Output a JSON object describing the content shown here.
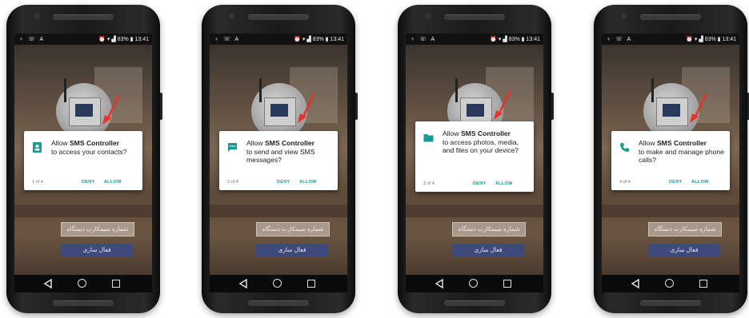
{
  "status_bar": {
    "left_icons": "♀ ☏ A",
    "right_icons": "⏰ ▾ ▟ 83% ▮",
    "time": "13:41"
  },
  "phones": [
    {
      "dialog": {
        "line1_prefix": "Allow",
        "app_name": "SMS Controller",
        "message": "to access your contacts?",
        "counter": "1 of 4",
        "deny": "DENY",
        "allow": "ALLOW",
        "icon": "contacts-icon"
      }
    },
    {
      "dialog": {
        "line1_prefix": "Allow",
        "app_name": "SMS Controller",
        "message": "to send and view SMS messages?",
        "counter": "2 of 4",
        "deny": "DENY",
        "allow": "ALLOW",
        "icon": "sms-icon"
      }
    },
    {
      "dialog": {
        "line1_prefix": "Allow",
        "app_name": "SMS Controller",
        "message": "to access photos, media, and files on your device?",
        "counter": "3 of 4",
        "deny": "DENY",
        "allow": "ALLOW",
        "icon": "folder-icon"
      }
    },
    {
      "dialog": {
        "line1_prefix": "Allow",
        "app_name": "SMS Controller",
        "message": "to make and manage phone calls?",
        "counter": "4 of 4",
        "deny": "DENY",
        "allow": "ALLOW",
        "icon": "phone-icon"
      }
    }
  ],
  "app": {
    "field_label": "شماره سیمکارت دستگاه",
    "activate_button": "فعال سازی"
  },
  "colors": {
    "accent": "#1a9a94",
    "arrow": "#e8322a",
    "button": "#3e4a7a"
  }
}
